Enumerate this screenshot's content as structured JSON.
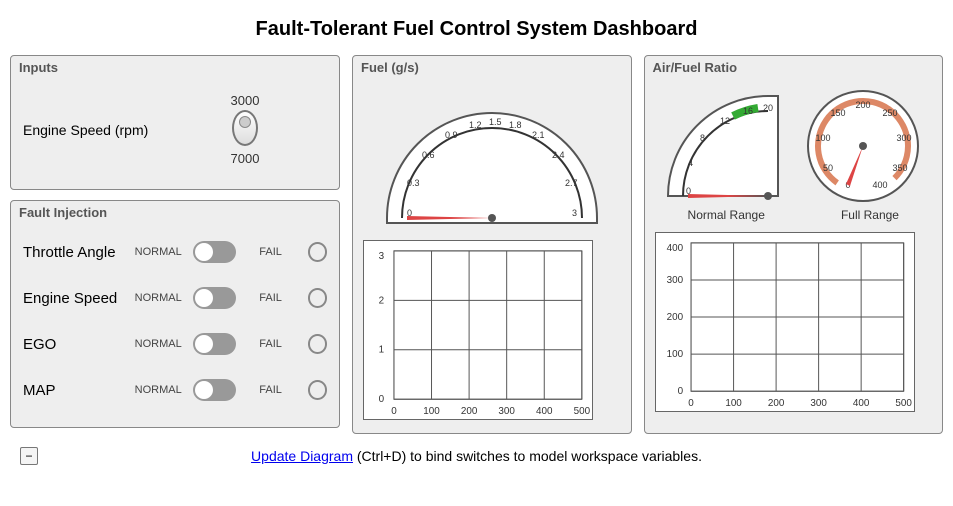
{
  "title": "Fault-Tolerant Fuel Control System Dashboard",
  "inputs": {
    "panel_title": "Inputs",
    "label": "Engine Speed (rpm)",
    "knob_min": "3000",
    "knob_max": "7000"
  },
  "faults": {
    "panel_title": "Fault Injection",
    "normal": "NORMAL",
    "fail": "FAIL",
    "items": [
      {
        "name": "Throttle Angle"
      },
      {
        "name": "Engine Speed"
      },
      {
        "name": "EGO"
      },
      {
        "name": "MAP"
      }
    ]
  },
  "fuel": {
    "panel_title": "Fuel (g/s)",
    "gauge_ticks": [
      "0",
      "0.3",
      "0.6",
      "0.9",
      "1.2",
      "1.5",
      "1.8",
      "2.1",
      "2.4",
      "2.7",
      "3"
    ]
  },
  "airfuel": {
    "panel_title": "Air/Fuel Ratio",
    "normal_label": "Normal Range",
    "full_label": "Full Range",
    "normal_ticks": [
      "0",
      "4",
      "8",
      "12",
      "16",
      "20"
    ],
    "full_ticks": [
      "0",
      "50",
      "100",
      "150",
      "200",
      "250",
      "300",
      "350",
      "400"
    ]
  },
  "chart_data": [
    {
      "type": "line",
      "title": "Fuel (g/s)",
      "xlabel": "",
      "ylabel": "",
      "xlim": [
        0,
        500
      ],
      "ylim": [
        0,
        3
      ],
      "x_ticks": [
        0,
        100,
        200,
        300,
        400,
        500
      ],
      "y_ticks": [
        0,
        1,
        2,
        3
      ],
      "series": []
    },
    {
      "type": "line",
      "title": "Air/Fuel Ratio",
      "xlabel": "",
      "ylabel": "",
      "xlim": [
        0,
        500
      ],
      "ylim": [
        0,
        400
      ],
      "x_ticks": [
        0,
        100,
        200,
        300,
        400,
        500
      ],
      "y_ticks": [
        0,
        100,
        200,
        300,
        400
      ],
      "series": []
    }
  ],
  "footer": {
    "link": "Update Diagram",
    "rest": " (Ctrl+D) to bind switches to model workspace variables."
  }
}
